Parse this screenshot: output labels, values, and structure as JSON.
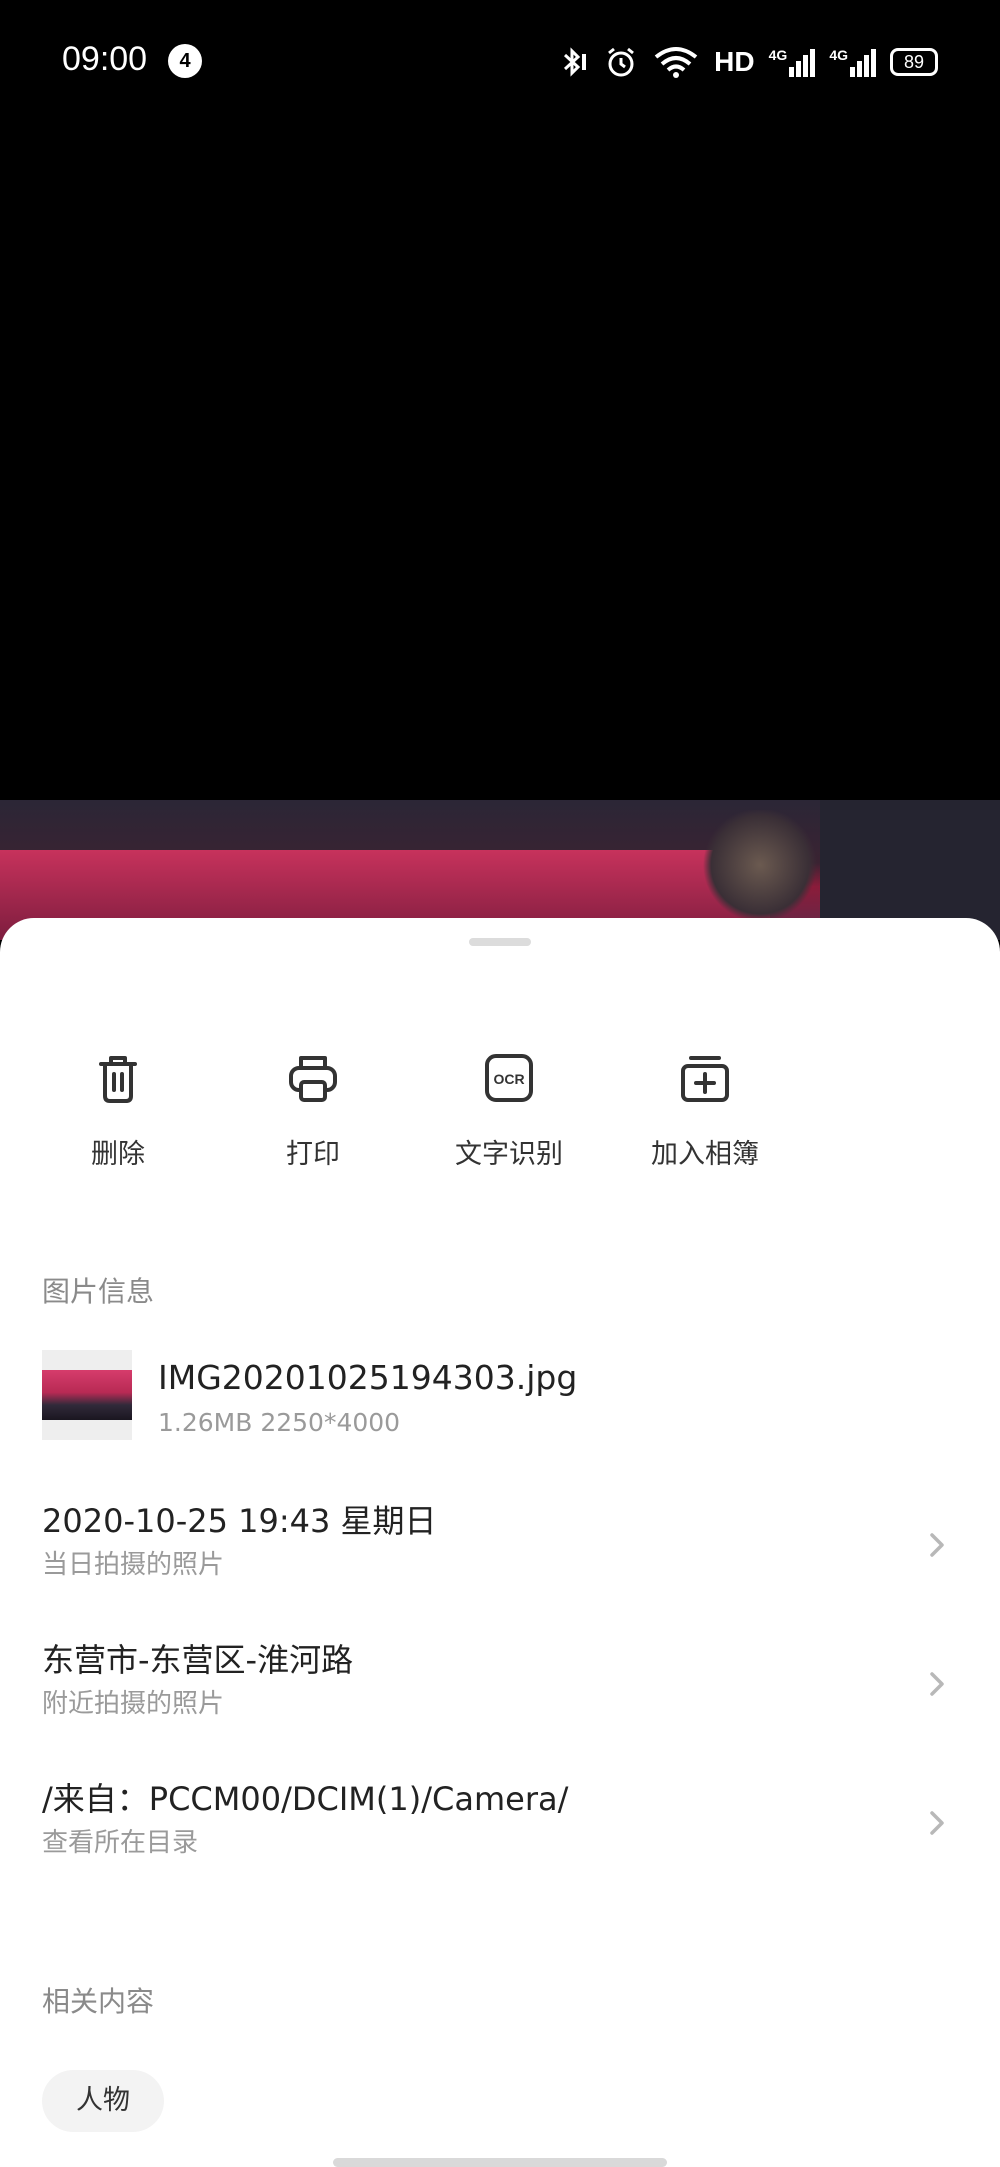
{
  "status_bar": {
    "time": "09:00",
    "notification_count": "4",
    "hd_label": "HD",
    "signal_1_label": "4G",
    "signal_2_label": "4G",
    "battery_level": "89"
  },
  "actions": [
    {
      "label": "删除",
      "icon": "trash-icon"
    },
    {
      "label": "打印",
      "icon": "printer-icon"
    },
    {
      "label": "文字识别",
      "icon": "ocr-icon"
    },
    {
      "label": "加入相簿",
      "icon": "add-to-album-icon"
    }
  ],
  "ocr_icon_text": "OCR",
  "image_info": {
    "section_title": "图片信息",
    "file_name": "IMG20201025194303.jpg",
    "file_meta": "1.26MB 2250*4000",
    "date_row": {
      "title": "2020-10-25 19:43 星期日",
      "subtitle": "当日拍摄的照片"
    },
    "location_row": {
      "title": "东营市-东营区-淮河路",
      "subtitle": "附近拍摄的照片"
    },
    "path_row": {
      "title": "/来自：PCCM00/DCIM(1)/Camera/",
      "subtitle": "查看所在目录"
    }
  },
  "related": {
    "section_title": "相关内容",
    "chips": [
      "人物"
    ]
  }
}
